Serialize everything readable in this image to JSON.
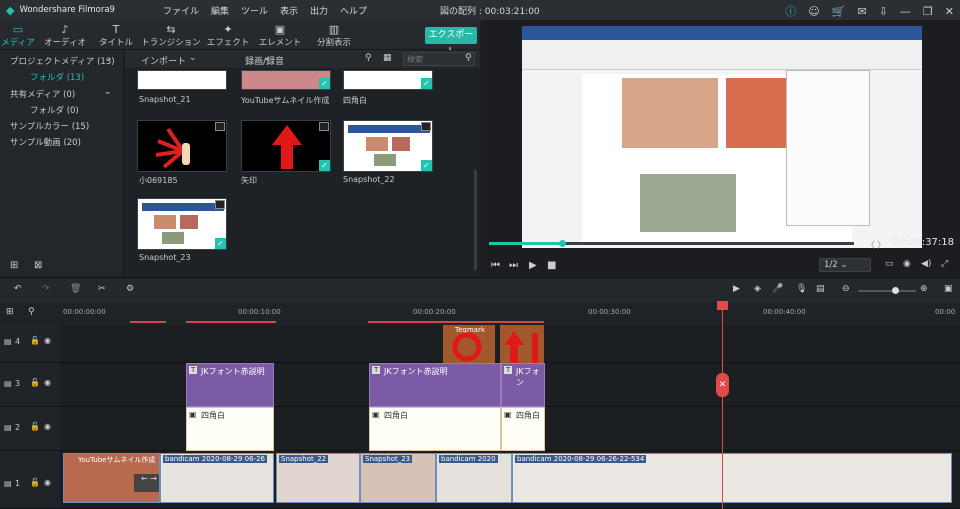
{
  "app": {
    "title": "Wondershare Filmora9",
    "project_info": "図の配列 : 00:03:21:00"
  },
  "menu": [
    "ファイル",
    "編集",
    "ツール",
    "表示",
    "出力",
    "ヘルプ"
  ],
  "toolbar": {
    "tabs": [
      "メディア",
      "オーディオ",
      "タイトル",
      "トランジション",
      "エフェクト",
      "エレメント",
      "分割表示"
    ],
    "export_label": "エクスポート"
  },
  "sidebar": {
    "items": [
      "プロジェクトメディア (13)",
      "フォルダ (13)",
      "共有メディア (0)",
      "フォルダ (0)",
      "サンプルカラー (15)",
      "サンプル動画 (20)"
    ]
  },
  "media_panel": {
    "import_label": "インポート",
    "record_label": "録画/録音",
    "search_placeholder": "検索",
    "items": [
      {
        "label": "Snapshot_21",
        "checked": false
      },
      {
        "label": "YouTubeサムネイル作成",
        "checked": true
      },
      {
        "label": "四角白",
        "checked": true
      },
      {
        "label": "小069185",
        "checked": false
      },
      {
        "label": "矢印",
        "checked": true
      },
      {
        "label": "Snapshot_22",
        "checked": true
      },
      {
        "label": "Snapshot_23",
        "checked": true
      }
    ]
  },
  "preview": {
    "timecode": "00:00:37:18",
    "zoom": "1/2",
    "progress": 0.2
  },
  "timeline": {
    "ruler": [
      "00:00:00:00",
      "00:00:10:00",
      "00:00:20:00",
      "00:00:30:00",
      "00:00:40:00",
      "00:00"
    ],
    "tracks": [
      {
        "label": "4"
      },
      {
        "label": "3"
      },
      {
        "label": "2"
      },
      {
        "label": "1"
      }
    ],
    "clips": {
      "track4": [
        "Tegmark"
      ],
      "track3": [
        "JKフォント赤説明",
        "JKフォント赤説明",
        "JKフォン"
      ],
      "track2": [
        "四角白",
        "四角白",
        "四角白"
      ],
      "track1": [
        "YouTubeサムネイル作成",
        "bandicam 2020-08-29 06-26",
        "Snapshot_22",
        "Snapshot_23",
        "bandicam 2020",
        "bandicam 2020-08-29 06-26-22-534"
      ]
    }
  }
}
